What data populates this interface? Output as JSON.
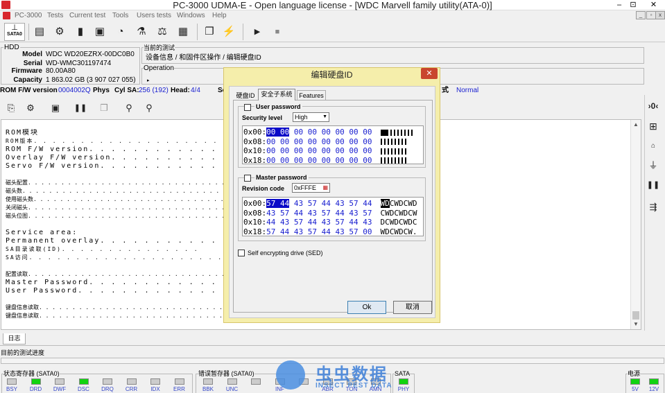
{
  "window": {
    "title": "PC-3000 UDMA-E - Open language license - [WDC Marvell family utility(ATA-0)]",
    "controls": [
      "–",
      "⊡",
      "✕"
    ]
  },
  "menu": {
    "items": [
      "PC-3000",
      "Tests",
      "Current test",
      "Tools",
      "Users tests",
      "Windows",
      "Help"
    ],
    "mdi": [
      "_",
      "▫",
      "x"
    ]
  },
  "toolbar": {
    "sata_label": "SATA0",
    "icons": [
      "notepad-icon",
      "gear-tools-icon",
      "chip-icon",
      "device-icon",
      "disk-head-icon",
      "flask-icon",
      "scale-icon",
      "grid-icon",
      "copy-icon",
      "run-steps-icon",
      "play-icon",
      "stop-icon"
    ]
  },
  "hdd": {
    "group_label": "HDD",
    "rows": [
      {
        "k": "Model",
        "v": "WDC WD20EZRX-00DC0B0"
      },
      {
        "k": "Serial",
        "v": "WD-WMC301197474"
      },
      {
        "k": "Firmware",
        "v": "80.00A80"
      },
      {
        "k": "Capacity",
        "v": "1 863.02 GB (3 907 027 055)"
      }
    ]
  },
  "current": {
    "group_label": "当前的测试",
    "path": "设备信息 / 和固件区操作 / 编辑硬盘ID",
    "operation_label": "Operation",
    "arrow": "▸"
  },
  "infoline": {
    "rom_label": "ROM F/W version",
    "rom_val": "0004002Q",
    "phys": "Phys",
    "cyl_label": "Cyl SA:",
    "cyl_val": "256 (192)",
    "head_label": "Head:",
    "head_val": "4/4",
    "trunc": "Se",
    "mode_label": "式",
    "mode_val": "Normal"
  },
  "log": {
    "lines": [
      "ROM模块",
      "ROM版本. . . . . . . . . . . . . . . . . . . . . . . . . . . . . .",
      "ROM F/W version. . . . . . . . . . . . . . .",
      "Overlay F/W version. . . . . . . . . . . .",
      "Servo F/W version. . . . . . . . . . . . .",
      "",
      "磁头配置. . . . . . . . . . . . . . . . . . . . . . . . . . . . . . . .",
      "磁头数. . . . . . . . . . . . . . . . . . . . . . . . . . . . . . . .",
      "使用磁头数. . . . . . . . . . . . . . . . . . . . . . . . . . . . . .",
      "关闭磁头. . . . . . . . . . . . . . . . . . . . . . . . . . . . . . .",
      "磁头位图. . . . . . . . . . . . . . . . . . . . . . . . . . . . . . .",
      "",
      "Service area:",
      "Permanent overlay. . . . . . . . . . . .",
      "SA目录读取(ID). . . . . . . . . . . . . . .",
      "SA访问. . . . . . . . . . . . . . . . . . . . . . . . . . . . . . .",
      "",
      "配置读取. . . . . . . . . . . . . . . . . . . . . . . . . . . . . . .",
      "Master Password. . . . . . . . . . . . . .",
      "User Password. . . . . . . . . . . . . . .",
      "",
      "键盘信息读取. . . . . . . . . . . . . . . . . . . . . . . . . . . . .",
      "键盘信息读取. . . . . . . . . . . . . . . . . . . . . . . . . . . . ."
    ]
  },
  "bottom": {
    "log_tab": "日志",
    "progress_label": "目前的测试进度",
    "status_reg_label": "状态寄存器 (SATA0)",
    "error_reg_label": "错误暂存器 (SATA0)",
    "sata_label": "SATA",
    "power_label": "电源"
  },
  "leds": {
    "status": [
      {
        "n": "BSY",
        "on": false
      },
      {
        "n": "DRD",
        "on": true
      },
      {
        "n": "DWF",
        "on": false
      },
      {
        "n": "DSC",
        "on": true
      },
      {
        "n": "DRQ",
        "on": false
      },
      {
        "n": "CRR",
        "on": false
      },
      {
        "n": "IDX",
        "on": false
      },
      {
        "n": "ERR",
        "on": false
      }
    ],
    "error": [
      {
        "n": "BBK",
        "on": false
      },
      {
        "n": "UNC",
        "on": false
      },
      {
        "n": "",
        "on": false
      },
      {
        "n": "INF",
        "on": false
      },
      {
        "n": "",
        "on": false
      },
      {
        "n": "ABR",
        "on": false
      },
      {
        "n": "TON",
        "on": false
      },
      {
        "n": "AMN",
        "on": false
      }
    ],
    "sata": [
      {
        "n": "PHY",
        "on": true
      }
    ],
    "power": [
      {
        "n": "5V",
        "on": true
      },
      {
        "n": "12V",
        "on": true
      }
    ]
  },
  "dialog": {
    "title": "编辑硬盘ID",
    "close": "✕",
    "tabs": [
      "硬盘ID",
      "安全子系统",
      "Features"
    ],
    "user": {
      "label": "User password",
      "sec_label": "Security level",
      "sec_val": "High",
      "hex": [
        [
          "0x00:",
          "00 00 00 00 00 00 00 00"
        ],
        [
          "0x08:",
          "00 00 00 00 00 00 00 00"
        ],
        [
          "0x10:",
          "00 00 00 00 00 00 00 00"
        ],
        [
          "0x18:",
          "00 00 00 00 00 00 00 00"
        ]
      ]
    },
    "master": {
      "label": "Master password",
      "rev_label": "Revision code",
      "rev_val": "0xFFFE",
      "hex": [
        [
          "0x00:",
          "57 44 43 57 44 43 57 44",
          "WDCWDCWD"
        ],
        [
          "0x08:",
          "43 57 44 43 57 44 43 57",
          "CWDCWDCW"
        ],
        [
          "0x10:",
          "44 43 57 44 43 57 44 43",
          "DCWDCWDC"
        ],
        [
          "0x18:",
          "57 44 43 57 44 43 57 00",
          "WDCWDCW."
        ]
      ]
    },
    "sed_label": "Self encrypting drive (SED)",
    "ok": "Ok",
    "cancel": "取消"
  },
  "watermark": {
    "title": "虫虫数据",
    "sub": "INSECT PEST DATA"
  },
  "colors": {
    "accent": "#0a0ac8",
    "led_on": "#11d311",
    "dialog_frame": "#f5eeab",
    "title_red": "#d8262c"
  }
}
